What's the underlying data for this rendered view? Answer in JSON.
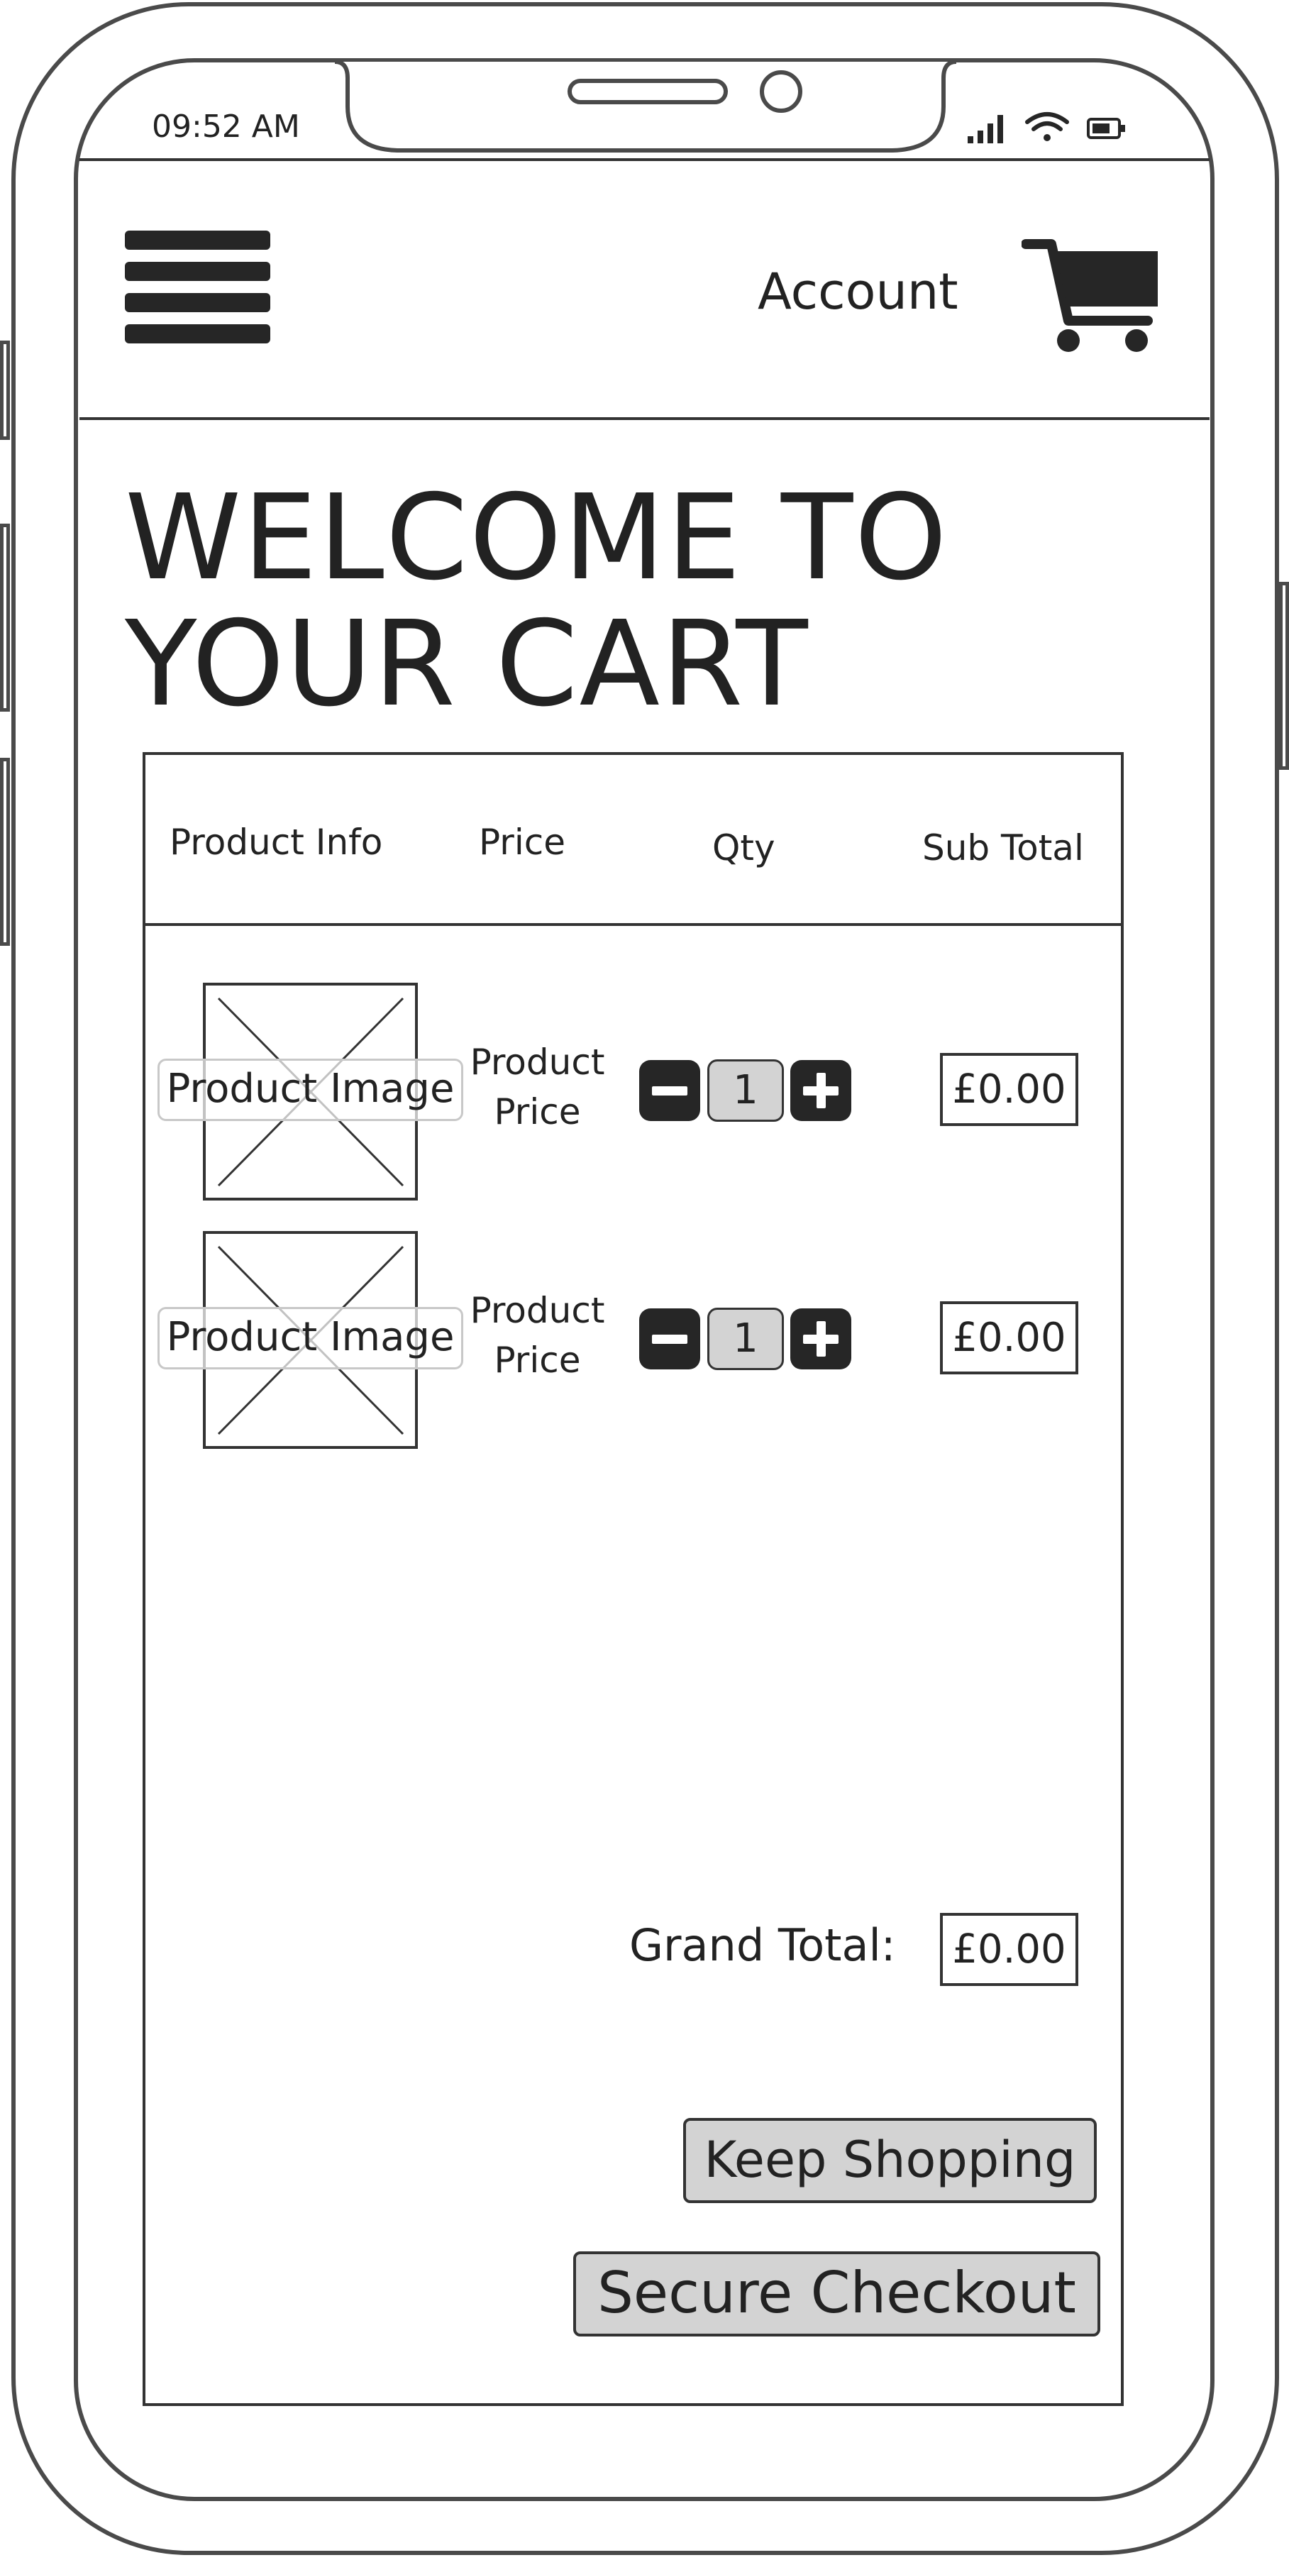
{
  "status_bar": {
    "time": "09:52 AM",
    "icons": [
      "signal-icon",
      "wifi-icon",
      "battery-icon"
    ]
  },
  "header": {
    "menu_icon": "hamburger-menu-icon",
    "account_label": "Account",
    "cart_icon": "shopping-cart-icon"
  },
  "page": {
    "title_line1": "WELCOME TO",
    "title_line2": "YOUR CART"
  },
  "table": {
    "headers": [
      "Product Info",
      "Price",
      "Qty",
      "Sub Total"
    ],
    "rows": [
      {
        "image_label": "Product Image",
        "price_line1": "Product",
        "price_line2": "Price",
        "qty": "1",
        "subtotal": "£0.00"
      },
      {
        "image_label": "Product Image",
        "price_line1": "Product",
        "price_line2": "Price",
        "qty": "1",
        "subtotal": "£0.00"
      }
    ]
  },
  "totals": {
    "grand_total_label": "Grand Total:",
    "grand_total_value": "£0.00"
  },
  "actions": {
    "keep_shopping": "Keep Shopping",
    "secure_checkout": "Secure Checkout"
  },
  "colors": {
    "outline": "#333333",
    "button_fill": "#d3d3d3",
    "icon_fill": "#262626"
  }
}
